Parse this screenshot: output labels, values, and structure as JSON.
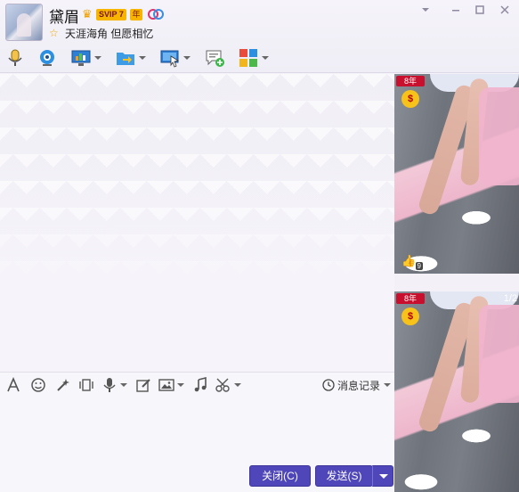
{
  "contact": {
    "name": "黛眉",
    "vip_badge": "SVIP 7",
    "year_badge": "年",
    "signature": "天涯海角 但愿相忆"
  },
  "window_controls": [
    "chevron-down-icon",
    "minimize-icon",
    "maximize-icon",
    "close-icon"
  ],
  "toolbar": {
    "items": [
      {
        "icon": "microphone-icon",
        "has_dropdown": false
      },
      {
        "icon": "webcam-icon",
        "has_dropdown": false
      },
      {
        "icon": "screen-share-icon",
        "has_dropdown": true
      },
      {
        "icon": "file-transfer-icon",
        "has_dropdown": true
      },
      {
        "icon": "remote-assist-icon",
        "has_dropdown": true
      },
      {
        "icon": "create-discussion-icon",
        "has_dropdown": false
      },
      {
        "icon": "apps-icon",
        "has_dropdown": true
      }
    ]
  },
  "input_toolbar": {
    "history_label": "消息记录"
  },
  "buttons": {
    "close_label": "关闭(C)",
    "send_label": "发送(S)"
  },
  "show_panel": {
    "badge_label": "年",
    "page_indicator": "1/2",
    "like_count": "9",
    "accent_color": "#4e46b9"
  }
}
